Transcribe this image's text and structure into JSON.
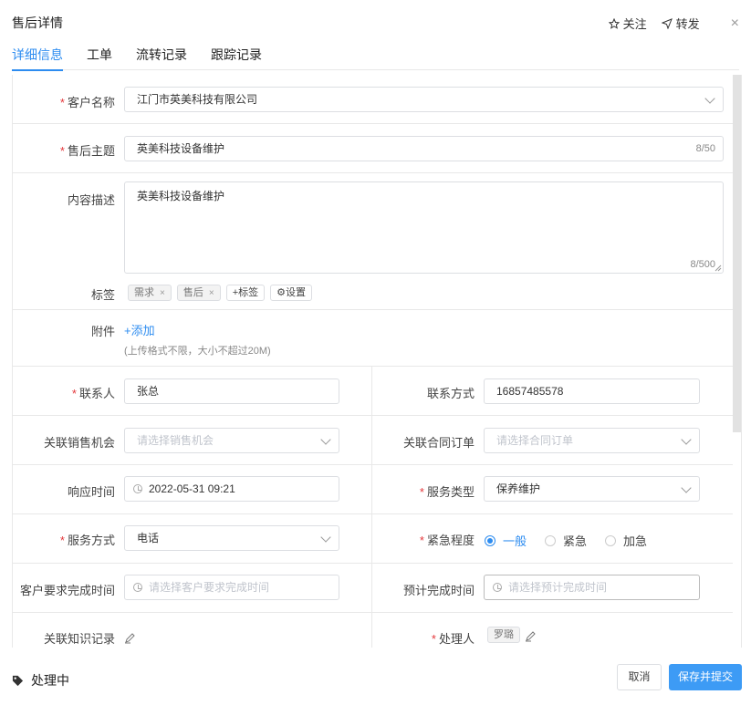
{
  "header": {
    "title": "售后详情",
    "follow_label": "关注",
    "forward_label": "转发",
    "close_label": "×"
  },
  "tabs": [
    {
      "label": "详细信息",
      "active": true
    },
    {
      "label": "工单",
      "active": false
    },
    {
      "label": "流转记录",
      "active": false
    },
    {
      "label": "跟踪记录",
      "active": false
    }
  ],
  "form": {
    "customer": {
      "label": "客户名称",
      "value": "江门市英美科技有限公司"
    },
    "subject": {
      "label": "售后主题",
      "value": "英美科技设备维护",
      "count": "8/50"
    },
    "description": {
      "label": "内容描述",
      "value": "英美科技设备维护",
      "count": "8/500"
    },
    "tags": {
      "label": "标签",
      "items": [
        "需求",
        "售后"
      ],
      "add_label": "+标签",
      "settings_label": "设置"
    },
    "attachment": {
      "label": "附件",
      "add_label": "+添加",
      "hint": "(上传格式不限，大小不超过20M)"
    },
    "contact": {
      "label": "联系人",
      "value": "张总"
    },
    "contact_phone": {
      "label": "联系方式",
      "value": "16857485578"
    },
    "opportunity": {
      "label": "关联销售机会",
      "placeholder": "请选择销售机会"
    },
    "contract": {
      "label": "关联合同订单",
      "placeholder": "请选择合同订单"
    },
    "response_time": {
      "label": "响应时间",
      "value": "2022-05-31 09:21"
    },
    "service_type": {
      "label": "服务类型",
      "value": "保养维护"
    },
    "service_method": {
      "label": "服务方式",
      "value": "电话"
    },
    "urgency": {
      "label": "紧急程度",
      "options": [
        "一般",
        "紧急",
        "加急"
      ],
      "selected": "一般"
    },
    "required_time": {
      "label": "客户要求完成时间",
      "placeholder": "请选择客户要求完成时间"
    },
    "expected_time": {
      "label": "预计完成时间",
      "placeholder": "请选择预计完成时间"
    },
    "knowledge": {
      "label": "关联知识记录"
    },
    "handler": {
      "label": "处理人",
      "value": "罗璐"
    }
  },
  "footer": {
    "status": "处理中",
    "cancel_label": "取消",
    "submit_label": "保存并提交"
  },
  "colors": {
    "accent": "#2d8cf0",
    "primary_button": "#3d9bf5",
    "required": "#e4393c"
  }
}
